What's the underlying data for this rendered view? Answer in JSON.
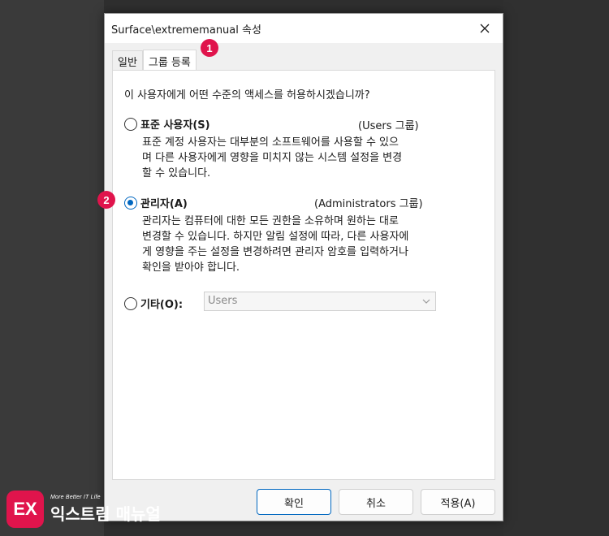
{
  "window": {
    "title": "Surface\\extrememanual 속성"
  },
  "tabs": [
    {
      "label": "일반"
    },
    {
      "label": "그룹 등록"
    }
  ],
  "question": "이 사용자에게 어떤 수준의 액세스를 허용하시겠습니까?",
  "options": {
    "standard": {
      "label": "표준 사용자(S)",
      "group": "(Users 그룹)",
      "desc": [
        "표준 계정 사용자는 대부분의 소프트웨어를 사용할 수 있으",
        "며 다른 사용자에게 영향을 미치지 않는 시스템 설정을 변경",
        "할 수 있습니다."
      ]
    },
    "admin": {
      "label": "관리자(A)",
      "group": "(Administrators 그룹)",
      "desc": [
        "관리자는 컴퓨터에 대한 모든 권한을 소유하며 원하는 대로",
        "변경할 수 있습니다. 하지만 알림 설정에 따라, 다른 사용자에",
        "게 영향을 주는 설정을 변경하려면 관리자 암호를 입력하거나",
        "확인을 받아야 합니다."
      ]
    },
    "other": {
      "label": "기타(O):",
      "select_value": "Users"
    }
  },
  "buttons": {
    "ok": "확인",
    "cancel": "취소",
    "apply": "적용(A)"
  },
  "badges": [
    "1",
    "2"
  ],
  "logo": {
    "mark": "EX",
    "tagline": "More Better IT Life",
    "name": "익스트림 매뉴얼"
  },
  "colors": {
    "accent": "#0067c0",
    "badge": "#e0144c"
  }
}
